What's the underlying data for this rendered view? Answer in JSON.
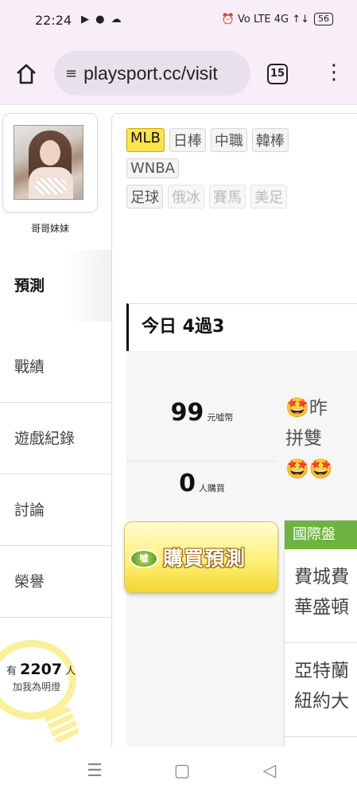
{
  "status_bar": {
    "time": "22:24",
    "notifications": "▶ ● ☁",
    "right_icons": "⏰ Vo LTE 4G ↑↓",
    "battery": "56"
  },
  "browser": {
    "url": "playsport.cc/visit",
    "tab_count": "15"
  },
  "profile": {
    "username": "哥哥妹妹"
  },
  "side_nav": {
    "items": [
      {
        "label": "預測"
      },
      {
        "label": "戰績"
      },
      {
        "label": "遊戲紀錄"
      },
      {
        "label": "討論"
      },
      {
        "label": "榮譽"
      }
    ]
  },
  "fans": {
    "prefix": "有",
    "count": "2207",
    "suffix": "人",
    "caption": "加我為明燈"
  },
  "sports": {
    "row1": [
      "MLB",
      "日棒",
      "中職",
      "韓棒"
    ],
    "row2": [
      "WNBA"
    ],
    "row3": [
      "足球",
      "俄冰",
      "賽馬",
      "美足"
    ],
    "active": "MLB"
  },
  "today": {
    "title": "今日 4過3"
  },
  "stats": {
    "price_value": "99",
    "price_unit": "元噓幣",
    "buyers_value": "0",
    "buyers_unit": "人購買"
  },
  "promo": {
    "line1": "昨",
    "line2": "拼雙",
    "emoji": "🤩"
  },
  "buy_button": {
    "coin": "噓",
    "label": "購買預測"
  },
  "intl": {
    "header": "國際盤",
    "matches": [
      {
        "line1": "費城費",
        "line2": "華盛頓"
      },
      {
        "line1": "亞特蘭",
        "line2": "紐約大"
      }
    ]
  },
  "android_nav": {
    "recents": "☰",
    "home": "▢",
    "back": "◁"
  }
}
